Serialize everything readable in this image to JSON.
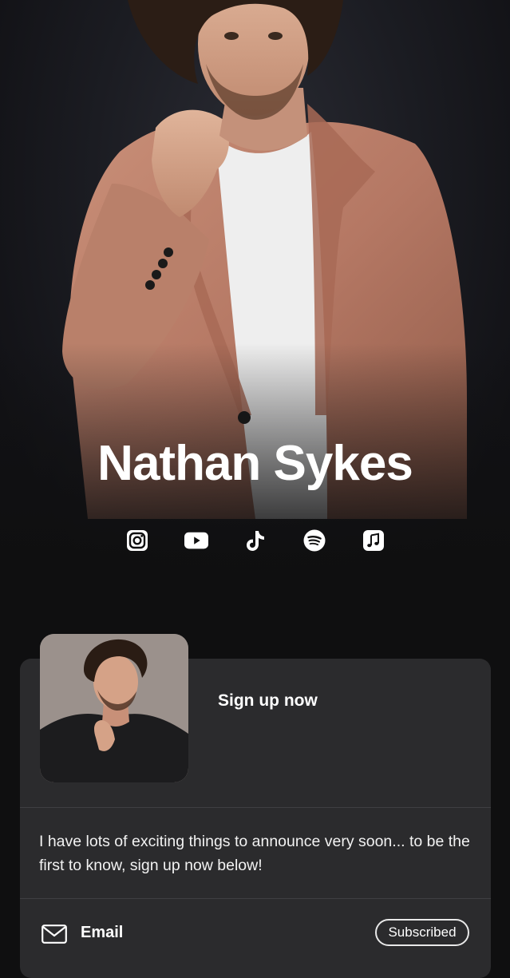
{
  "profile": {
    "name": "Nathan Sykes"
  },
  "social_links": [
    {
      "icon": "instagram-icon"
    },
    {
      "icon": "youtube-icon"
    },
    {
      "icon": "tiktok-icon"
    },
    {
      "icon": "spotify-icon"
    },
    {
      "icon": "apple-music-icon"
    }
  ],
  "signup_card": {
    "title": "Sign up now",
    "description": "I have lots of exciting things to announce very soon... to be the first to know, sign up now below!",
    "email_label": "Email",
    "subscribe_button": "Subscribed"
  },
  "colors": {
    "background": "#0f0f10",
    "card": "#2b2b2d",
    "text": "#ffffff"
  }
}
